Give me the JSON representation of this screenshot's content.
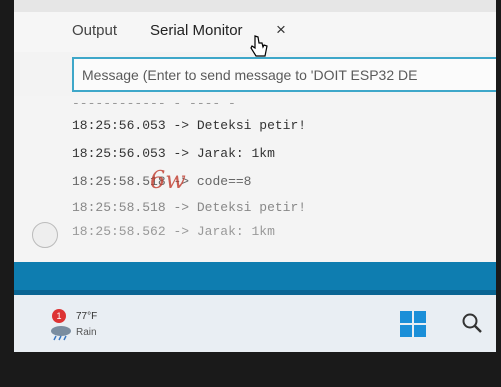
{
  "tabs": {
    "output_label": "Output",
    "serial_label": "Serial Monitor",
    "close_glyph": "×"
  },
  "message_input": {
    "placeholder": "Message (Enter to send message to 'DOIT ESP32 DE"
  },
  "console": {
    "partial_top_line": "------------ - ---- -",
    "lines": [
      {
        "time": "18:25:56.053",
        "arrow": "->",
        "text": "Deteksi petir!"
      },
      {
        "time": "18:25:56.053",
        "arrow": "->",
        "text": "Jarak: 1km"
      },
      {
        "time": "18:25:58.518",
        "arrow": "->",
        "text": "code==8"
      },
      {
        "time": "18:25:58.518",
        "arrow": "->",
        "text": "Deteksi petir!"
      },
      {
        "time": "18:25:58.562",
        "arrow": "->",
        "text": "Jarak: 1km"
      }
    ],
    "handwritten_mark": "6w"
  },
  "taskbar": {
    "weather_badge": "1",
    "weather_temp": "77°F",
    "weather_condition": "Rain"
  },
  "colors": {
    "accent": "#3ea7c9",
    "status_bar": "#0e7db0",
    "taskbar": "#e9eef3"
  }
}
